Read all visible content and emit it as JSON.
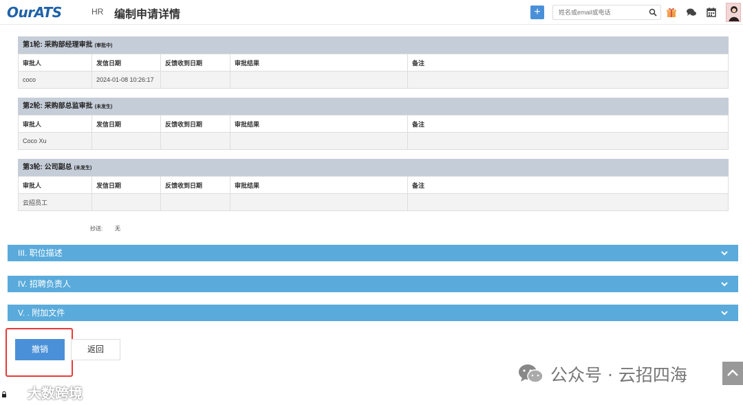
{
  "header": {
    "logo": "OurATS",
    "nav": "HR",
    "title": "编制申请详情",
    "add_label": "+",
    "search_placeholder": "姓名或email或电话",
    "icons": [
      "gift-icon",
      "chat-icon",
      "calendar-icon",
      "avatar"
    ]
  },
  "rounds": [
    {
      "title": "第1轮: 采购部经理审批",
      "status": "(审批中)",
      "columns": [
        "审批人",
        "发信日期",
        "反馈收到日期",
        "审批结果",
        "备注"
      ],
      "rows": [
        [
          "coco",
          "2024-01-08 10:26:17",
          "",
          "",
          ""
        ]
      ]
    },
    {
      "title": "第2轮: 采购部总监审批",
      "status": "(未发生)",
      "columns": [
        "审批人",
        "发信日期",
        "反馈收到日期",
        "审批结果",
        "备注"
      ],
      "rows": [
        [
          "Coco Xu",
          "",
          "",
          "",
          ""
        ]
      ]
    },
    {
      "title": "第3轮: 公司副总",
      "status": "(未发生)",
      "columns": [
        "审批人",
        "发信日期",
        "反馈收到日期",
        "审批结果",
        "备注"
      ],
      "rows": [
        [
          "云招员工",
          "",
          "",
          "",
          ""
        ]
      ]
    }
  ],
  "cc": {
    "label": "抄送:",
    "value": "无"
  },
  "sections": [
    "III. 职位描述",
    "IV. 招聘负责人",
    "V. . 附加文件"
  ],
  "buttons": {
    "cancel": "撤销",
    "back": "返回"
  },
  "watermarks": {
    "right": "公众号 · 云招四海",
    "left": "大数跨境"
  },
  "colors": {
    "accent": "#4a90d9",
    "section_bar": "#5aabdb",
    "round_header": "#c5cdd8",
    "highlight": "#e53935"
  }
}
